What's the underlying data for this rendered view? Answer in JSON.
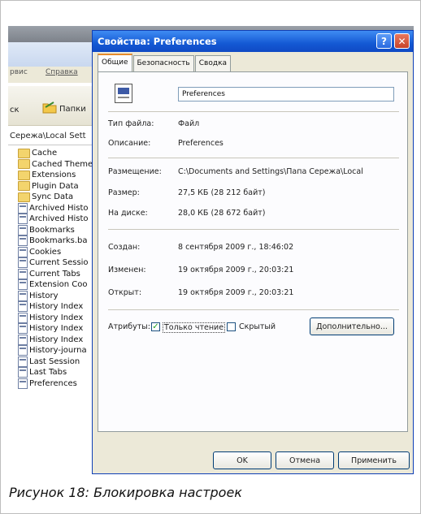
{
  "explorer": {
    "menu_items": [
      "рвис",
      "Справка"
    ],
    "toolbar_back_label": "ск",
    "toolbar_folders_label": "Папки",
    "address": "Сережа\\Local Sett",
    "folders": [
      "Cache",
      "Cached Theme",
      "Extensions",
      "Plugin Data",
      "Sync Data"
    ],
    "files": [
      "Archived Histo",
      "Archived Histo",
      "Bookmarks",
      "Bookmarks.ba",
      "Cookies",
      "Current Sessio",
      "Current Tabs",
      "Extension Coo",
      "History",
      "History Index",
      "History Index",
      "History Index",
      "History Index",
      "History-journa",
      "Last Session",
      "Last Tabs",
      "Preferences"
    ]
  },
  "dialog": {
    "title": "Свойства: Preferences",
    "help_button": "?",
    "close_button": "✕",
    "tabs": [
      {
        "label": "Общие"
      },
      {
        "label": "Безопасность"
      },
      {
        "label": "Сводка"
      }
    ],
    "file_name": "Preferences",
    "type_label": "Тип файла:",
    "type_value": "Файл",
    "description_label": "Описание:",
    "description_value": "Preferences",
    "location_label": "Размещение:",
    "location_value": "C:\\Documents and Settings\\Папа Сережа\\Local",
    "size_label": "Размер:",
    "size_value": "27,5 КБ (28 212 байт)",
    "disk_size_label": "На диске:",
    "disk_size_value": "28,0 КБ (28 672 байт)",
    "created_label": "Создан:",
    "created_value": "8 сентября 2009 г., 18:46:02",
    "modified_label": "Изменен:",
    "modified_value": "19 октября 2009 г., 20:03:21",
    "accessed_label": "Открыт:",
    "accessed_value": "19 октября 2009 г., 20:03:21",
    "attributes_label": "Атрибуты:",
    "readonly_label": "Только чтение",
    "readonly_checked": "✓",
    "hidden_label": "Скрытый",
    "advanced_button": "Дополнительно...",
    "ok_button": "OK",
    "cancel_button": "Отмена",
    "apply_button": "Применить"
  },
  "caption": "Рисунок 18: Блокировка настроек"
}
